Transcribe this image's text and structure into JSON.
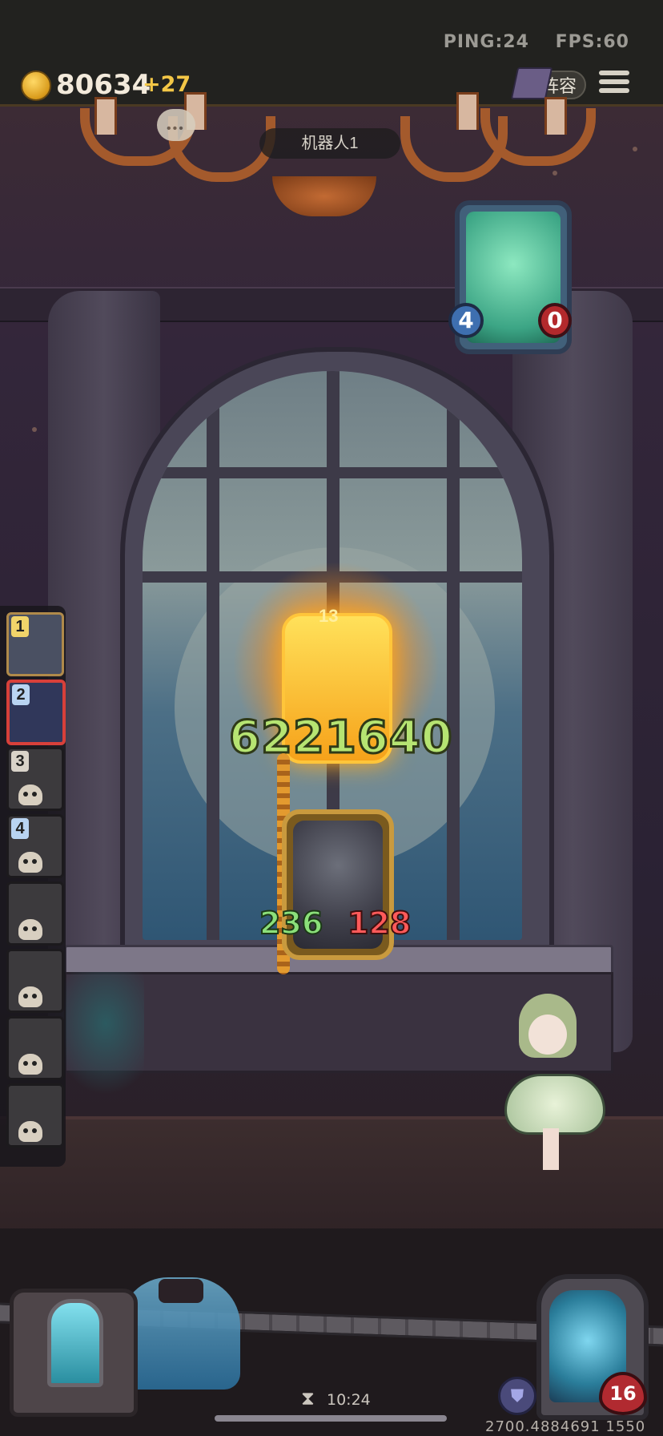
{
  "status": {
    "ping": "PING:24",
    "fps": "FPS:60"
  },
  "currency": {
    "coins": "80634",
    "delta": "+27"
  },
  "toolbar": {
    "lineup_label": "阵容"
  },
  "opponent": {
    "name": "机器人1"
  },
  "opponent_card": {
    "attack": "4",
    "health": "0"
  },
  "battle": {
    "damage": "6221640",
    "glow_card_value": "13"
  },
  "player_card": {
    "attack": "236",
    "health": "128"
  },
  "roster": [
    {
      "rank": "1",
      "rank_color": "#f1d46a"
    },
    {
      "rank": "2",
      "rank_color": "#b9d4f2"
    },
    {
      "rank": "3",
      "rank_color": "#d9d3c9"
    },
    {
      "rank": "4",
      "rank_color": "#b9d4f2"
    },
    {
      "rank": ""
    },
    {
      "rank": ""
    },
    {
      "rank": ""
    },
    {
      "rank": ""
    }
  ],
  "footer": {
    "timer": "10:24",
    "debug": "2700.4884691 1550",
    "hero_health": "16"
  }
}
